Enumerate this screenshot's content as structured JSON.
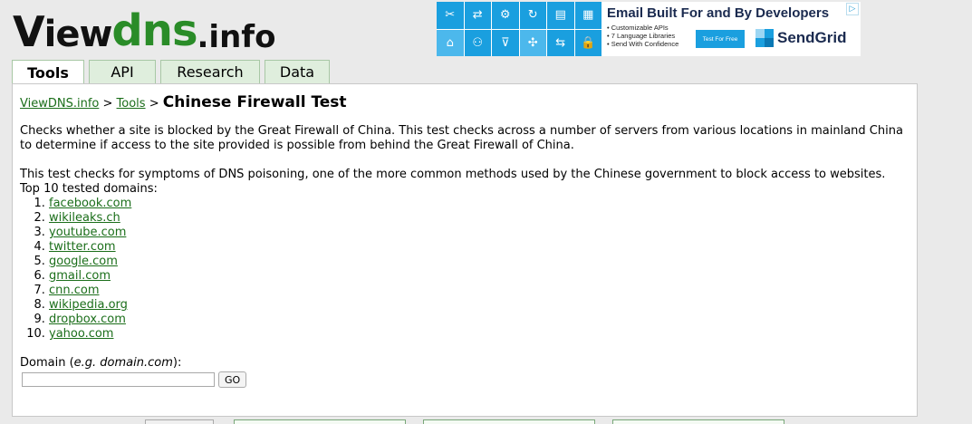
{
  "logo": {
    "v": "V",
    "iew": "iew",
    "dns": "dns",
    "info": ".info"
  },
  "ad": {
    "title": "Email Built For and By Developers",
    "bullets": [
      "• Customizable APIs",
      "• 7 Language Libraries",
      "• Send With Confidence"
    ],
    "cta": "Test For Free",
    "brand": "SendGrid",
    "adchoices_icon": "adchoices-icon",
    "accent": "#1a9fdf",
    "tiles": [
      "✂",
      "⇄",
      "⚙",
      "↻",
      "▤",
      "▦",
      "⌂",
      "⚇",
      "⊽",
      "✣",
      "⇆",
      "🔒"
    ]
  },
  "tabs": [
    {
      "label": "Tools",
      "active": true
    },
    {
      "label": "API",
      "active": false
    },
    {
      "label": "Research",
      "active": false
    },
    {
      "label": "Data",
      "active": false
    }
  ],
  "breadcrumb": {
    "home": "ViewDNS.info",
    "sep1": " > ",
    "tools": "Tools",
    "sep2": " > ",
    "current": "Chinese Firewall Test"
  },
  "description": {
    "p1": "Checks whether a site is blocked by the Great Firewall of China. This test checks across a number of servers from various locations in mainland China to determine if access to the site provided is possible from behind the Great Firewall of China.",
    "p2": "This test checks for symptoms of DNS poisoning, one of the more common methods used by the Chinese government to block access to websites.",
    "list_heading": "Top 10 tested domains:"
  },
  "top_domains": [
    "facebook.com",
    "wikileaks.ch",
    "youtube.com",
    "twitter.com",
    "google.com",
    "gmail.com",
    "cnn.com",
    "wikipedia.org",
    "dropbox.com",
    "yahoo.com"
  ],
  "form": {
    "label_prefix": "Domain (",
    "label_example": "e.g. domain.com",
    "label_suffix": "):",
    "input_value": "",
    "go_label": "GO"
  },
  "colors": {
    "link": "#1b6e1a",
    "logo_green": "#2a8c28",
    "tab_bg": "#dfeedd"
  }
}
